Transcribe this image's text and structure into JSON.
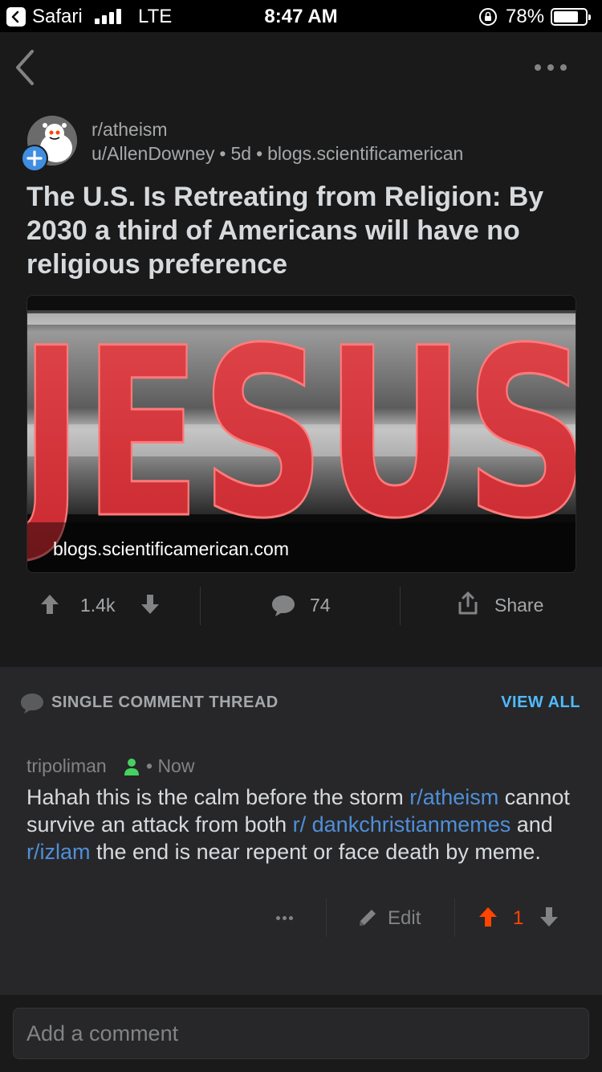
{
  "status_bar": {
    "app": "Safari",
    "network": "LTE",
    "time": "8:47 AM",
    "battery": "78%",
    "battery_level": 0.78
  },
  "nav": {
    "back_icon": "chevron-left-icon",
    "more_icon": "ellipsis-icon"
  },
  "post": {
    "subreddit": "r/atheism",
    "author": "u/AllenDowney",
    "age": "5d",
    "source": "blogs.scientificamerican",
    "separator": "•",
    "title": "The U.S. Is Retreating from Religion: By 2030 a third of Americans will have no religious preference",
    "link_domain": "blogs.scientificamerican.com",
    "image_letters": "JESUS",
    "votes": "1.4k",
    "comments": "74",
    "share_label": "Share"
  },
  "thread": {
    "label": "SINGLE COMMENT THREAD",
    "view_all": "VIEW ALL"
  },
  "comment": {
    "author": "tripoliman",
    "time": "• Now",
    "body_parts": {
      "t1": "Hahah this is the calm before the storm ",
      "link1": "r/atheism",
      "t2": " cannot survive an attack from both ",
      "link2": "r/ dankchristianmemes",
      "t3": " and ",
      "link3": "r/izlam",
      "t4": " the end is near repent or face death by meme."
    },
    "edit_label": "Edit",
    "score": "1"
  },
  "composer": {
    "placeholder": "Add a comment"
  },
  "colors": {
    "background": "#1a1a1b",
    "card": "#272729",
    "upvote": "#ff4500",
    "link": "#4f8fd9",
    "view_all": "#4fbcff",
    "avatar_plus": "#3f8ee0"
  }
}
